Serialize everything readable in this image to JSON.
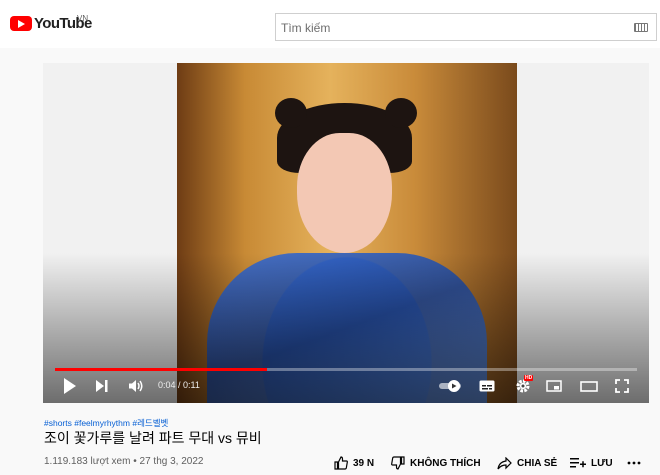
{
  "header": {
    "logo_text": "YouTube",
    "country_code": "VN",
    "search_placeholder": "Tìm kiếm"
  },
  "player": {
    "time_current": "0:04",
    "time_separator": " / ",
    "time_total": "0:11",
    "progress_fraction": 0.364,
    "hd_badge": "HD"
  },
  "video": {
    "hashtags": "#shorts #feelmyrhythm #레드벨벳",
    "title": "조이 꽃가루를 날려 파트 무대 vs 뮤비",
    "views": "1.119.183 lượt xem",
    "dot": " • ",
    "date": "27 thg 3, 2022"
  },
  "actions": {
    "like_count": "39 N",
    "dislike_label": "KHÔNG THÍCH",
    "share_label": "CHIA SẺ",
    "save_label": "LƯU"
  },
  "colors": {
    "brand": "#ff0000",
    "link": "#065fd4",
    "progress": "#ff0000"
  }
}
